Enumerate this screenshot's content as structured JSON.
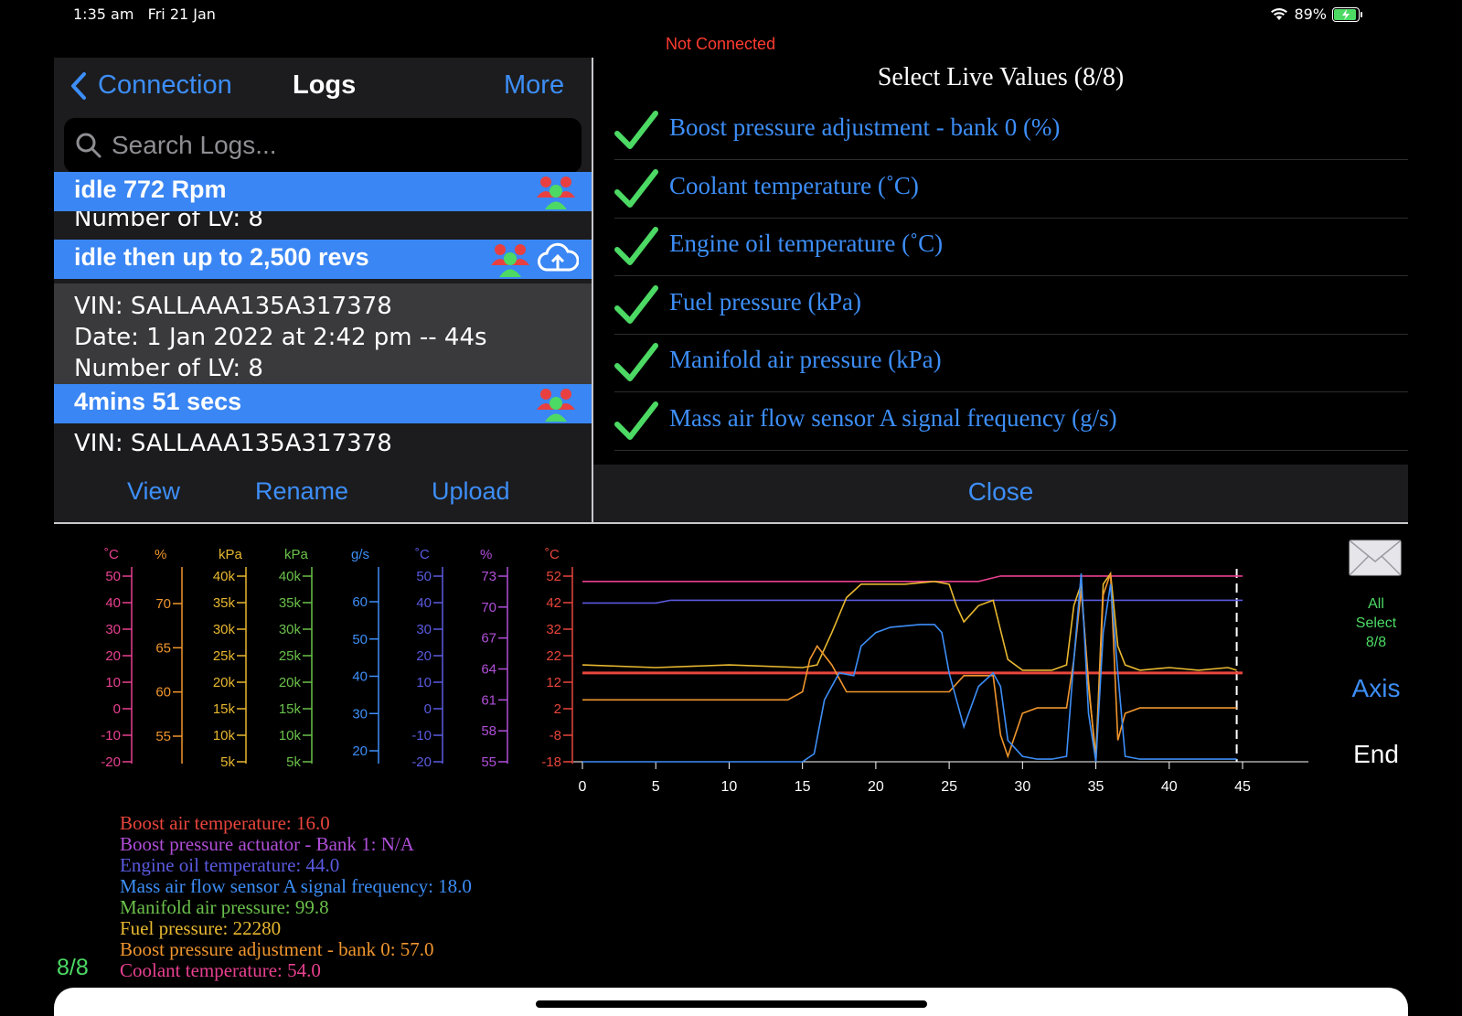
{
  "status_bar": {
    "time": "1:35 am",
    "date": "Fri 21 Jan",
    "battery": "89%"
  },
  "connection_status": "Not Connected",
  "nav": {
    "back_label": "Connection",
    "title": "Logs",
    "more_label": "More"
  },
  "search": {
    "placeholder": "Search Logs..."
  },
  "logs": [
    {
      "title": "idle 772 Rpm",
      "lines": [
        "Number of LV: 8"
      ]
    },
    {
      "title": "idle then up to 2,500 revs",
      "lines": [
        "VIN: SALLAAA135A317378",
        "Date: 1 Jan 2022 at 2:42 pm -- 44s",
        "Number of LV: 8"
      ]
    },
    {
      "title": "4mins 51 secs",
      "lines": [
        "VIN: SALLAAA135A317378"
      ]
    }
  ],
  "toolbar": {
    "view_label": "View",
    "rename_label": "Rename",
    "upload_label": "Upload"
  },
  "live_values": {
    "title": "Select Live Values (8/8)",
    "items": [
      "Boost pressure adjustment - bank 0 (%)",
      "Coolant temperature (˚C)",
      "Engine oil temperature (˚C)",
      "Fuel pressure (kPa)",
      "Manifold air pressure (kPa)",
      "Mass air flow sensor A signal frequency (g/s)"
    ],
    "close_label": "Close"
  },
  "side_controls": {
    "all_label": "All",
    "select_label": "Select",
    "count": "8/8",
    "axis_label": "Axis",
    "end_label": "End"
  },
  "count_label": "8/8",
  "legend": [
    {
      "text": "Boost air temperature: 16.0",
      "color": "#e8453c"
    },
    {
      "text": "Boost pressure actuator  -  Bank 1: N/A",
      "color": "#b04fd8"
    },
    {
      "text": "Engine oil temperature: 44.0",
      "color": "#5a5ae0"
    },
    {
      "text": "Mass air flow sensor A signal frequency: 18.0",
      "color": "#3d8ef7"
    },
    {
      "text": "Manifold air pressure: 99.8",
      "color": "#6ac04a"
    },
    {
      "text": "Fuel pressure: 22280",
      "color": "#e8b830"
    },
    {
      "text": "Boost pressure adjustment - bank 0: 57.0",
      "color": "#f0962e"
    },
    {
      "text": "Coolant temperature: 54.0",
      "color": "#e8408f"
    }
  ],
  "chart_data": {
    "type": "line",
    "xlim": [
      0,
      45
    ],
    "x_ticks": [
      "0",
      "5",
      "10",
      "15",
      "20",
      "25",
      "30",
      "35",
      "40",
      "45"
    ],
    "axes": [
      {
        "unit": "˚C",
        "color": "#e8408f",
        "ticks": [
          "50",
          "40",
          "30",
          "20",
          "10",
          "0",
          "-10",
          "-20"
        ]
      },
      {
        "unit": "%",
        "color": "#f0962e",
        "ticks": [
          "70",
          "65",
          "60",
          "55"
        ]
      },
      {
        "unit": "kPa",
        "color": "#e8b830",
        "ticks": [
          "40k",
          "35k",
          "30k",
          "25k",
          "20k",
          "15k",
          "10k",
          "5k"
        ]
      },
      {
        "unit": "kPa",
        "color": "#6ac04a",
        "ticks": [
          "40k",
          "35k",
          "30k",
          "25k",
          "20k",
          "15k",
          "10k",
          "5k"
        ]
      },
      {
        "unit": "g/s",
        "color": "#3d8ef7",
        "ticks": [
          "60",
          "50",
          "40",
          "30",
          "20"
        ]
      },
      {
        "unit": "˚C",
        "color": "#5a5ae0",
        "ticks": [
          "50",
          "40",
          "30",
          "20",
          "10",
          "0",
          "-10",
          "-20"
        ]
      },
      {
        "unit": "%",
        "color": "#b04fd8",
        "ticks": [
          "73",
          "70",
          "67",
          "64",
          "61",
          "58",
          "55"
        ]
      },
      {
        "unit": "˚C",
        "color": "#e8453c",
        "ticks": [
          "52",
          "42",
          "32",
          "22",
          "12",
          "2",
          "-8",
          "-18"
        ]
      }
    ],
    "series": [
      {
        "name": "Boost air temperature",
        "color": "#e8453c",
        "y_min": -18,
        "y_max": 52,
        "x": [
          0,
          45
        ],
        "y": [
          15,
          15
        ]
      },
      {
        "name": "Coolant temperature",
        "color": "#e8408f",
        "y_min": -18,
        "y_max": 52,
        "x": [
          0,
          27,
          28.5,
          45
        ],
        "y": [
          49,
          49,
          51,
          51
        ]
      },
      {
        "name": "Engine oil temperature",
        "color": "#5a5ae0",
        "y_min": -18,
        "y_max": 52,
        "x": [
          0,
          5,
          6,
          45
        ],
        "y": [
          41,
          41,
          42,
          42
        ]
      },
      {
        "name": "Fuel pressure",
        "color": "#e8b830",
        "y_min": -18,
        "y_max": 52,
        "x": [
          0,
          5,
          10,
          15,
          16,
          17,
          18,
          19,
          20,
          22,
          24,
          25,
          25.5,
          26,
          27,
          28,
          29,
          30,
          31,
          32,
          33,
          33.5,
          34,
          34.5,
          35,
          35.5,
          36,
          36.5,
          37,
          38,
          40,
          42,
          44,
          44.6
        ],
        "y": [
          18,
          17,
          18,
          17,
          18,
          30,
          43,
          48,
          48,
          48,
          49,
          48,
          40,
          34,
          40,
          42,
          20,
          16,
          16,
          16,
          18,
          40,
          48,
          10,
          -16,
          48,
          52,
          25,
          18,
          16,
          17,
          16,
          17,
          16
        ]
      },
      {
        "name": "Boost pressure adjustment - bank 0",
        "color": "#f0962e",
        "y_min": -18,
        "y_max": 52,
        "x": [
          0,
          5,
          10,
          14,
          15,
          15.5,
          16,
          17,
          18,
          19,
          20,
          22,
          24,
          25,
          26,
          27,
          28,
          28.5,
          29,
          30,
          31,
          32,
          33,
          33.5,
          34,
          34.5,
          35,
          35.5,
          36,
          36.5,
          37,
          38,
          40,
          42,
          44,
          44.6
        ],
        "y": [
          5,
          5,
          5,
          5,
          8,
          20,
          25,
          18,
          8,
          8,
          8,
          8,
          8,
          8,
          14,
          14,
          14,
          -8,
          -16,
          0,
          2,
          2,
          2,
          20,
          46,
          12,
          -18,
          44,
          52,
          -10,
          0,
          2,
          2,
          2,
          2,
          2
        ]
      },
      {
        "name": "Mass air flow sensor A signal frequency",
        "color": "#3d8ef7",
        "y_min": -18,
        "y_max": 52,
        "x": [
          0,
          5,
          10,
          15,
          15.8,
          16.5,
          17.5,
          18.5,
          19,
          20,
          21,
          23,
          24,
          24.5,
          25,
          25.5,
          26,
          27,
          28,
          28.5,
          29,
          30,
          31,
          32,
          33,
          33.5,
          34,
          34.5,
          35,
          35.5,
          36,
          36.5,
          37,
          38,
          40,
          42,
          44,
          44.6
        ],
        "y": [
          -18,
          -18,
          -18,
          -18,
          -15,
          5,
          15,
          14,
          25,
          30,
          32,
          33,
          33,
          30,
          15,
          5,
          -5,
          10,
          15,
          10,
          -10,
          -16,
          -17,
          -17,
          -16,
          20,
          52,
          0,
          -18,
          30,
          48,
          15,
          -16,
          -17,
          -17,
          -17,
          -17,
          -17
        ]
      }
    ]
  }
}
